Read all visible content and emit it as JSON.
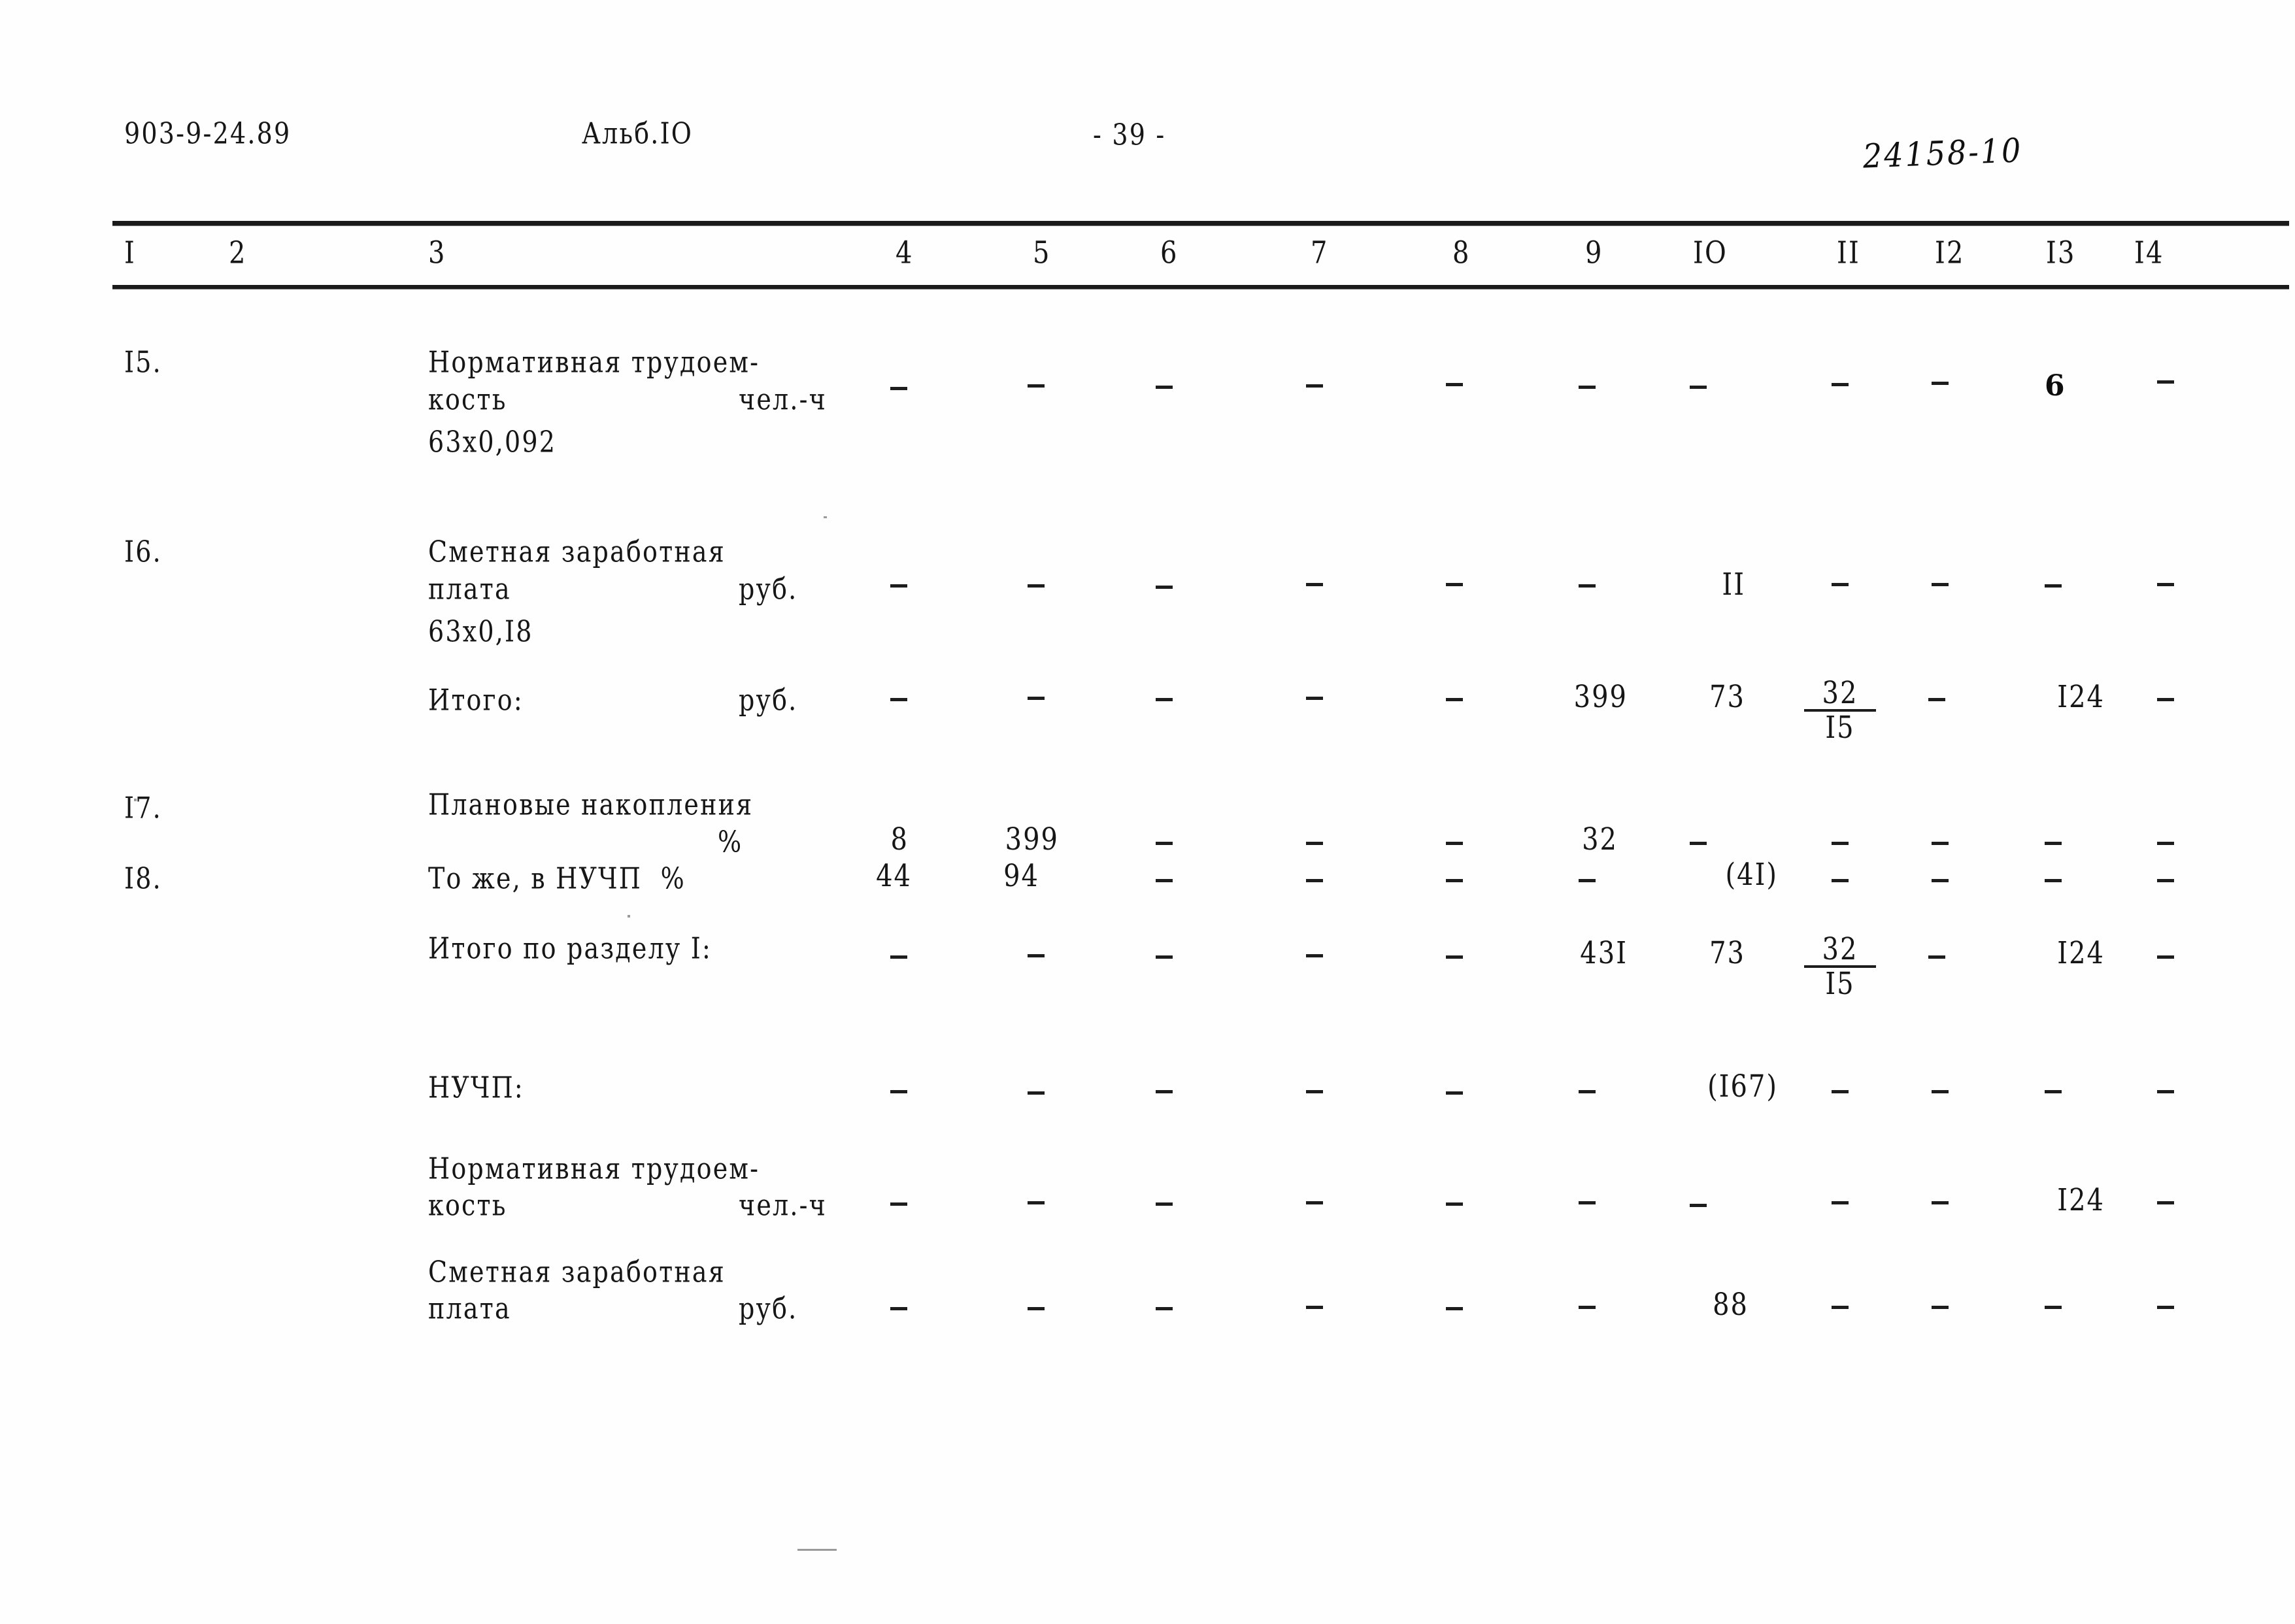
{
  "header": {
    "doc_code": "903-9-24.89",
    "album": "Альб.IO",
    "page_number": "- 39 -",
    "stamp": "24158-10"
  },
  "table": {
    "column_numbers": [
      "I",
      "2",
      "3",
      "4",
      "5",
      "6",
      "7",
      "8",
      "9",
      "IO",
      "II",
      "I2",
      "I3",
      "I4"
    ],
    "dash_glyph": "-",
    "rows": [
      {
        "no": "I5.",
        "name_line1": "Нормативная трудоем-",
        "name_line2": "кость",
        "unit": "чел.-ч",
        "name_line3": "63х0,092",
        "values": [
          "-",
          "-",
          "-",
          "-",
          "-",
          "-",
          "-",
          "-",
          "-",
          "6",
          "-"
        ]
      },
      {
        "no": "I6.",
        "name_line1": "Сметная заработная",
        "name_line2": "плата",
        "unit": "руб.",
        "name_line3": "63х0,I8",
        "values": [
          "-",
          "-",
          "-",
          "-",
          "-",
          "-",
          "II",
          "-",
          "-",
          "-",
          "-"
        ]
      },
      {
        "no": "",
        "name_line1": "Итого:",
        "name_line2": "",
        "unit": "руб.",
        "name_line3": "",
        "values": [
          "-",
          "-",
          "-",
          "-",
          "-",
          "399",
          "73",
          "32/I5",
          "-",
          "I24",
          "-"
        ]
      },
      {
        "no": "I7.",
        "name_line1": "Плановые накопления",
        "name_line2": "",
        "unit": "%",
        "name_line3": "",
        "values": [
          "8",
          "399",
          "-",
          "-",
          "-",
          "32",
          "-",
          "-",
          "-",
          "-",
          "-"
        ]
      },
      {
        "no": "I8.",
        "name_line1": "То же, в НУЧП  %",
        "name_line2": "",
        "unit": "",
        "name_line3": "",
        "values": [
          "44",
          "94",
          "-",
          "-",
          "-",
          "-",
          "(4I)",
          "-",
          "-",
          "-",
          "-"
        ]
      },
      {
        "no": "",
        "name_line1": "Итого по разделу I:",
        "name_line2": "",
        "unit": "",
        "name_line3": "",
        "values": [
          "-",
          "-",
          "-",
          "-",
          "-",
          "43I",
          "73",
          "32/I5",
          "-",
          "I24",
          "-"
        ]
      },
      {
        "no": "",
        "name_line1": "НУЧП:",
        "name_line2": "",
        "unit": "",
        "name_line3": "",
        "values": [
          "-",
          "-",
          "-",
          "-",
          "-",
          "-",
          "(I67)",
          "-",
          "-",
          "-",
          "-"
        ]
      },
      {
        "no": "",
        "name_line1": "Нормативная трудоем-",
        "name_line2": "кость",
        "unit": "чел.-ч",
        "name_line3": "",
        "values": [
          "-",
          "-",
          "-",
          "-",
          "-",
          "-",
          "-",
          "-",
          "-",
          "I24",
          "-"
        ]
      },
      {
        "no": "",
        "name_line1": "Сметная заработная",
        "name_line2": "плата",
        "unit": "руб.",
        "name_line3": "",
        "values": [
          "-",
          "-",
          "-",
          "-",
          "-",
          "-",
          "88",
          "-",
          "-",
          "-",
          "-"
        ]
      }
    ],
    "fractions": {
      "itogo": {
        "numerator": "32",
        "denominator": "I5"
      },
      "itogo_razdel": {
        "numerator": "32",
        "denominator": "I5"
      }
    }
  }
}
